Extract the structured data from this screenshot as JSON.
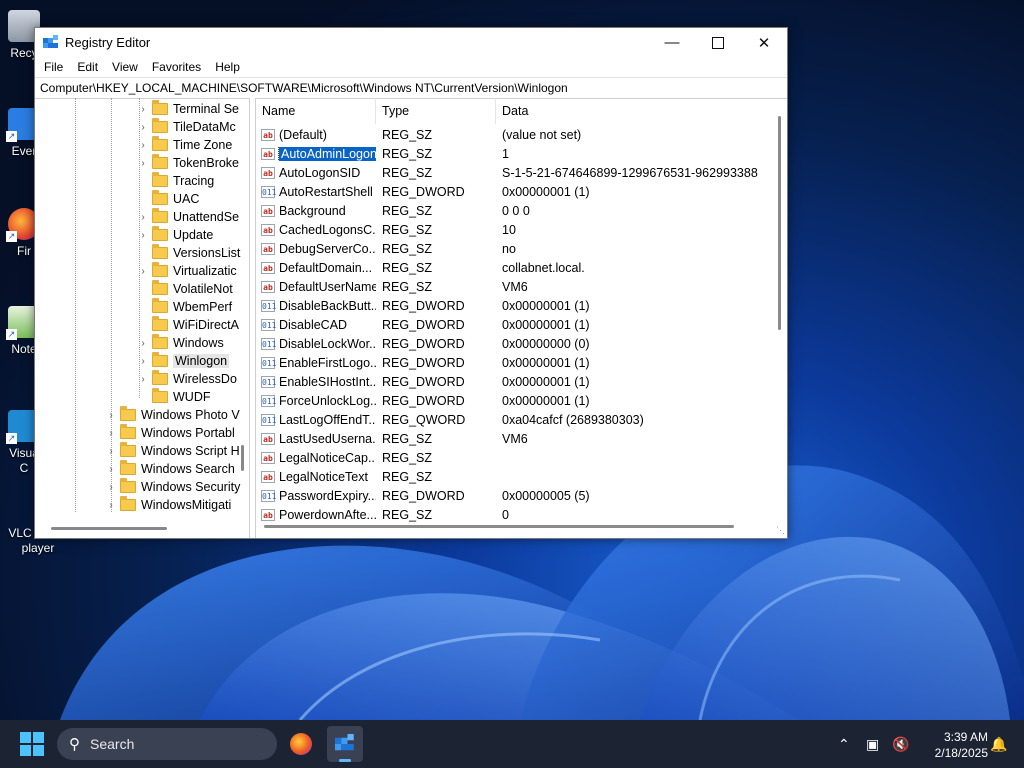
{
  "window": {
    "title": "Registry Editor",
    "menu": [
      "File",
      "Edit",
      "View",
      "Favorites",
      "Help"
    ],
    "address": "Computer\\HKEY_LOCAL_MACHINE\\SOFTWARE\\Microsoft\\Windows NT\\CurrentVersion\\Winlogon"
  },
  "tree": {
    "children": [
      "Terminal Se",
      "TileDataMc",
      "Time Zone",
      "TokenBroke",
      "Tracing",
      "UAC",
      "UnattendSe",
      "Update",
      "VersionsList",
      "Virtualizatic",
      "VolatileNot",
      "WbemPerf",
      "WiFiDirectA",
      "Windows",
      "Winlogon",
      "WirelessDo",
      "WUDF"
    ],
    "children_expandable": [
      true,
      true,
      true,
      true,
      false,
      false,
      true,
      true,
      false,
      true,
      false,
      false,
      false,
      true,
      true,
      true,
      false
    ],
    "selected": "Winlogon",
    "siblings": [
      "Windows Photo V",
      "Windows Portabl",
      "Windows Script H",
      "Windows Search",
      "Windows Security",
      "WindowsMitigati"
    ]
  },
  "list": {
    "headers": {
      "name": "Name",
      "type": "Type",
      "data": "Data"
    },
    "selected": "AutoAdminLogon",
    "rows": [
      {
        "name": "(Default)",
        "type": "REG_SZ",
        "data": "(value not set)",
        "icon": "string-value-icon"
      },
      {
        "name": "AutoAdminLogon",
        "type": "REG_SZ",
        "data": "1",
        "icon": "string-value-icon"
      },
      {
        "name": "AutoLogonSID",
        "type": "REG_SZ",
        "data": "S-1-5-21-674646899-1299676531-962993388",
        "icon": "string-value-icon"
      },
      {
        "name": "AutoRestartShell",
        "type": "REG_DWORD",
        "data": "0x00000001 (1)",
        "icon": "binary-value-icon"
      },
      {
        "name": "Background",
        "type": "REG_SZ",
        "data": "0 0 0",
        "icon": "string-value-icon"
      },
      {
        "name": "CachedLogonsC...",
        "type": "REG_SZ",
        "data": "10",
        "icon": "string-value-icon"
      },
      {
        "name": "DebugServerCo...",
        "type": "REG_SZ",
        "data": "no",
        "icon": "string-value-icon"
      },
      {
        "name": "DefaultDomain...",
        "type": "REG_SZ",
        "data": "collabnet.local.",
        "icon": "string-value-icon"
      },
      {
        "name": "DefaultUserName",
        "type": "REG_SZ",
        "data": "VM6",
        "icon": "string-value-icon"
      },
      {
        "name": "DisableBackButt...",
        "type": "REG_DWORD",
        "data": "0x00000001 (1)",
        "icon": "binary-value-icon"
      },
      {
        "name": "DisableCAD",
        "type": "REG_DWORD",
        "data": "0x00000001 (1)",
        "icon": "binary-value-icon"
      },
      {
        "name": "DisableLockWor...",
        "type": "REG_DWORD",
        "data": "0x00000000 (0)",
        "icon": "binary-value-icon"
      },
      {
        "name": "EnableFirstLogo...",
        "type": "REG_DWORD",
        "data": "0x00000001 (1)",
        "icon": "binary-value-icon"
      },
      {
        "name": "EnableSIHostInt...",
        "type": "REG_DWORD",
        "data": "0x00000001 (1)",
        "icon": "binary-value-icon"
      },
      {
        "name": "ForceUnlockLog...",
        "type": "REG_DWORD",
        "data": "0x00000001 (1)",
        "icon": "binary-value-icon"
      },
      {
        "name": "LastLogOffEndT...",
        "type": "REG_QWORD",
        "data": "0xa04cafcf (2689380303)",
        "icon": "binary-value-icon"
      },
      {
        "name": "LastUsedUserna...",
        "type": "REG_SZ",
        "data": "VM6",
        "icon": "string-value-icon"
      },
      {
        "name": "LegalNoticeCap...",
        "type": "REG_SZ",
        "data": "",
        "icon": "string-value-icon"
      },
      {
        "name": "LegalNoticeText",
        "type": "REG_SZ",
        "data": "",
        "icon": "string-value-icon"
      },
      {
        "name": "PasswordExpiry...",
        "type": "REG_DWORD",
        "data": "0x00000005 (5)",
        "icon": "binary-value-icon"
      },
      {
        "name": "PowerdownAfte...",
        "type": "REG_SZ",
        "data": "0",
        "icon": "string-value-icon"
      }
    ]
  },
  "desktop": {
    "icons": [
      {
        "label": "Recy",
        "icon": "recycle-bin-icon"
      },
      {
        "label": "Ever",
        "icon": "app-shortcut-icon"
      },
      {
        "label": "Fir",
        "icon": "firefox-icon"
      },
      {
        "label": "Note",
        "icon": "notepad-icon"
      },
      {
        "label": "Visua\nC",
        "icon": "visual-studio-code-icon"
      },
      {
        "label": "VLC media player",
        "icon": "vlc-icon"
      }
    ]
  },
  "taskbar": {
    "search_placeholder": "Search",
    "time": "3:39 AM",
    "date": "2/18/2025"
  },
  "colors": {
    "selection": "#0a64c8",
    "taskbar": "#1c2333",
    "folder": "#f7c94d",
    "accent": "#60b8ff"
  }
}
